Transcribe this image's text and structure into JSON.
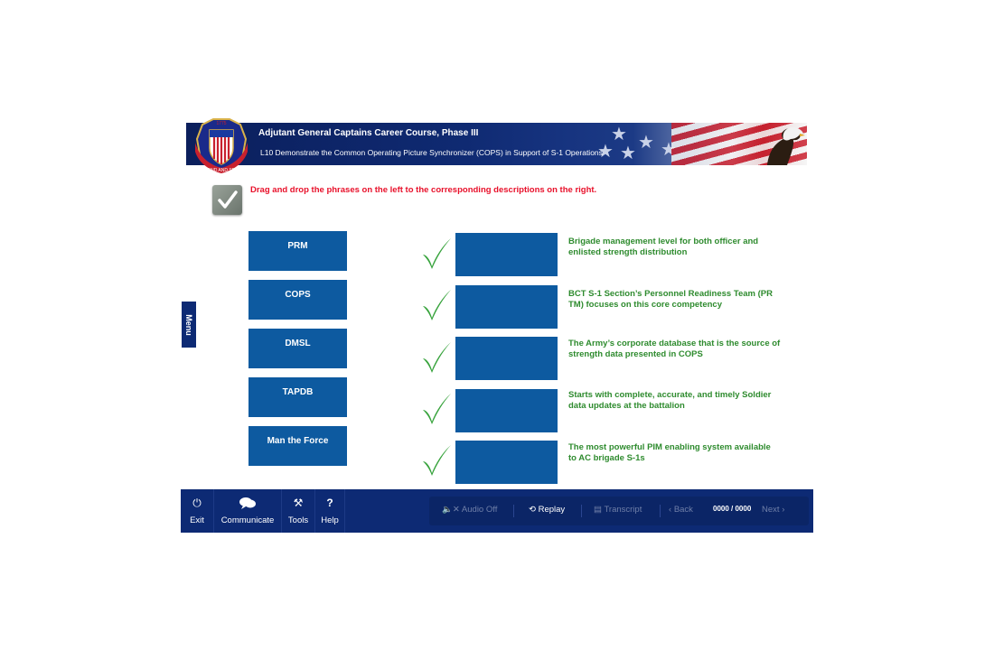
{
  "header": {
    "title": "Adjutant General Captains Career Course, Phase III",
    "subtitle": "L10 Demonstrate the Common Operating Picture Synchronizer (COPS) in Support of S-1 Operations",
    "logo_text": "DEFEND AND SERVE",
    "logo_year": "1775"
  },
  "instructions": "Drag and drop the phrases on the left to the corresponding descriptions on the right.",
  "menu_tab": "Menu",
  "terms": [
    "PRM",
    "COPS",
    "DMSL",
    "TAPDB",
    "Man the Force"
  ],
  "descriptions": [
    [
      "Brigade management level for both officer and",
      "enlisted strength distribution"
    ],
    [
      "BCT S-1 Section’s Personnel Readiness Team (PR",
      "TM) focuses on this core competency"
    ],
    [
      "The Army’s corporate database that is the source of",
      "strength data presented in COPS"
    ],
    [
      "Starts with complete, accurate, and timely Soldier",
      "data updates at the battalion"
    ],
    [
      "The most powerful PIM enabling system available",
      "to AC brigade S-1s"
    ]
  ],
  "footer": {
    "tools": [
      {
        "label": "Exit",
        "icon": "power-icon"
      },
      {
        "label": "Communicate",
        "icon": "chat-icon"
      },
      {
        "label": "Tools",
        "icon": "tools-icon"
      },
      {
        "label": "Help",
        "icon": "help-icon"
      }
    ],
    "player": {
      "audio": "Audio Off",
      "replay": "Replay",
      "transcript": "Transcript",
      "back": "Back",
      "counter": "0000 / 0000",
      "next": "Next"
    }
  },
  "colors": {
    "header_navy": "#0f2a72",
    "box_blue": "#0d5aa0",
    "desc_green": "#2e8b2e",
    "instruction_red": "#e8102a",
    "footer_navy": "#0d2a74"
  }
}
